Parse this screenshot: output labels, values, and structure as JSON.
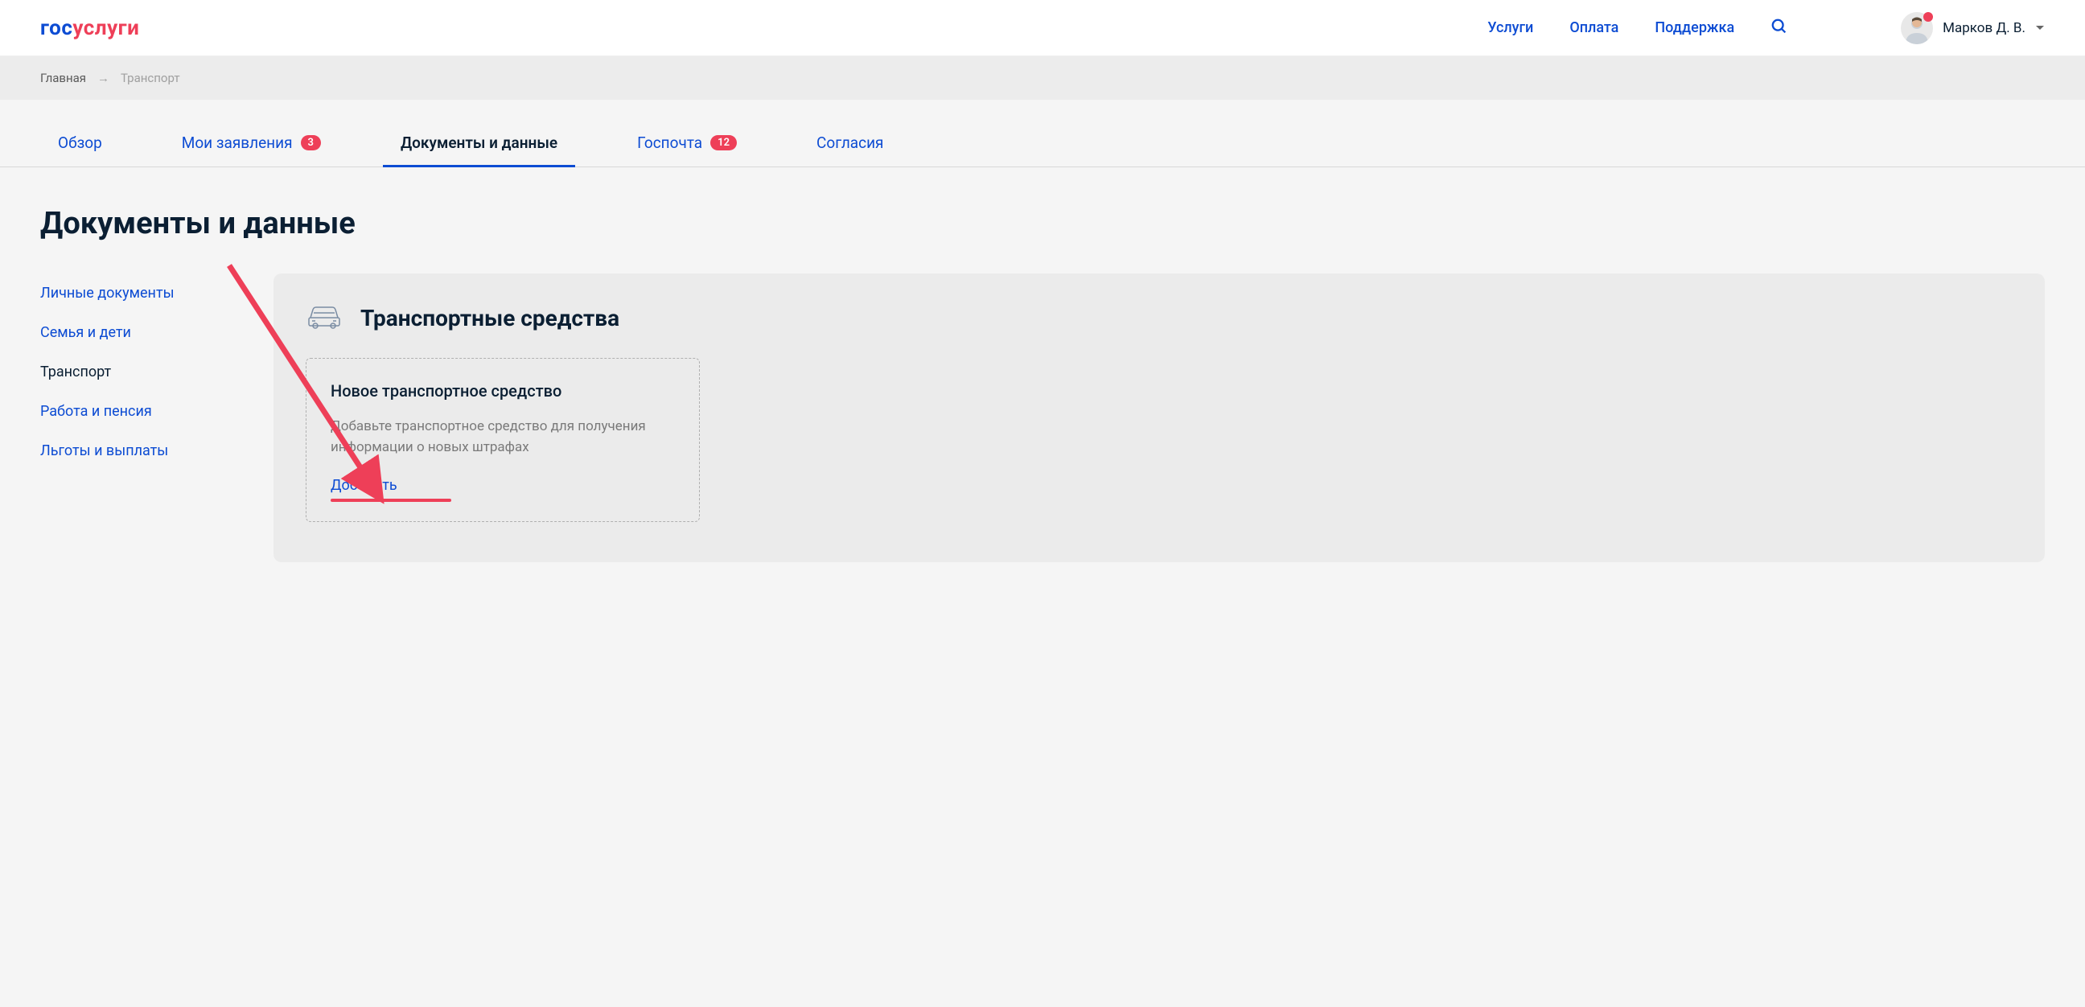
{
  "header": {
    "logo": {
      "part1": "гос",
      "part2": "услуги"
    },
    "nav": {
      "services": "Услуги",
      "payment": "Оплата",
      "support": "Поддержка"
    },
    "user_name": "Марков Д. В."
  },
  "breadcrumb": {
    "home": "Главная",
    "current": "Транспорт"
  },
  "tabs": {
    "overview": "Обзор",
    "applications": "Мои заявления",
    "applications_badge": "3",
    "documents": "Документы и данные",
    "gospochta": "Госпочта",
    "gospochta_badge": "12",
    "consents": "Согласия"
  },
  "page_title": "Документы и данные",
  "sidebar": {
    "personal": "Личные документы",
    "family": "Семья и дети",
    "transport": "Транспорт",
    "work": "Работа и пенсия",
    "benefits": "Льготы и выплаты"
  },
  "panel": {
    "title": "Транспортные средства",
    "card_title": "Новое транспортное средство",
    "card_desc": "Добавьте транспортное средство для получения информации о новых штрафах",
    "add_link": "Добавить"
  }
}
